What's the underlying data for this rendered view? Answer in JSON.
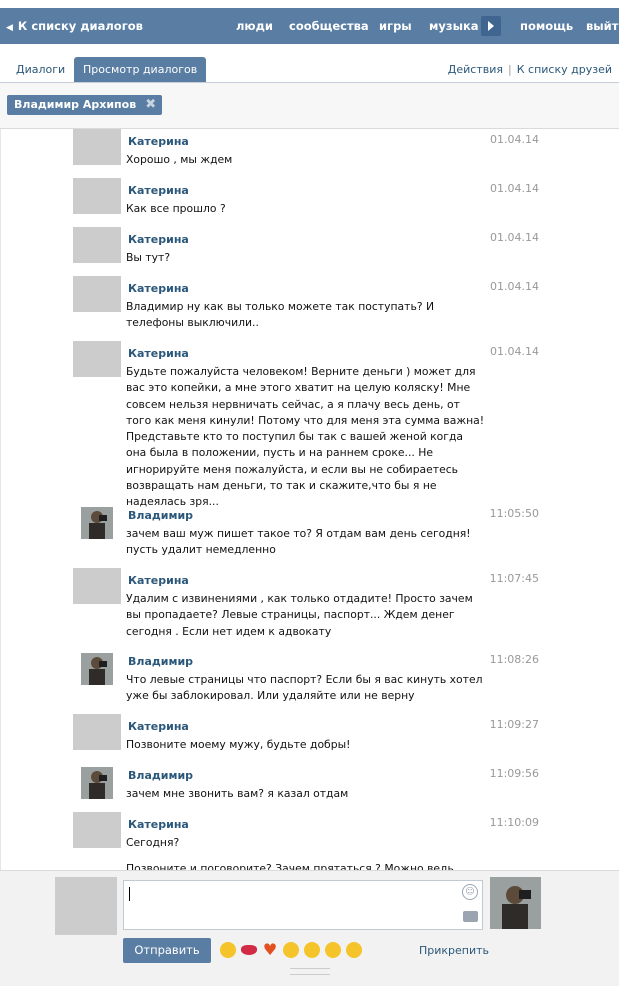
{
  "topbar": {
    "back_label": "К списку диалогов",
    "nav": [
      "люди",
      "сообщества",
      "игры",
      "музыка",
      "помощь",
      "выйти"
    ]
  },
  "tabs": [
    "Диалоги",
    "Просмотр диалогов"
  ],
  "actions": {
    "actions_label": "Действия",
    "friends_label": "К списку друзей"
  },
  "filter": {
    "chip_label": "Владимир Архипов"
  },
  "messages": [
    {
      "author": "Катерина",
      "time": "01.04.14",
      "text": "Хорошо , мы ждем"
    },
    {
      "author": "Катерина",
      "time": "01.04.14",
      "text": "Как все прошло ?"
    },
    {
      "author": "Катерина",
      "time": "01.04.14",
      "text": "Вы тут?"
    },
    {
      "author": "Катерина",
      "time": "01.04.14",
      "text": "Владимир ну как вы только можете так поступать? И телефоны выключили.."
    },
    {
      "author": "Катерина",
      "time": "01.04.14",
      "text": "Будьте пожалуйста человеком! Верните деньги ) может для вас это копейки, а мне этого хватит на целую коляску! Мне совсем нельзя нервничать сейчас, а я плачу весь день, от того как меня кинули! Потому что для меня эта сумма важна! Представьте кто то поступил бы так с вашей женой когда она была в положении, пусть и на раннем сроке... Не игнорируйте меня пожалуйста, и если вы не собираетесь возвращать нам деньги, то так и скажите,что бы я не надеялась зря..."
    },
    {
      "author": "Владимир",
      "time": "11:05:50",
      "text": "зачем ваш муж пишет такое то? Я отдам вам день сегодня! пусть удалит немедленно"
    },
    {
      "author": "Катерина",
      "time": "11:07:45",
      "text": "Удалим с извинениями , как только отдадите! Просто зачем вы пропадаете? Левые страницы, паспорт... Ждем денег сегодня . Если нет идем к адвокату"
    },
    {
      "author": "Владимир",
      "time": "11:08:26",
      "text": "Что левые страницы что паспорт? Если бы я вас кинуть хотел уже бы заблокировал. Или удаляйте или не верну"
    },
    {
      "author": "Катерина",
      "time": "11:09:27",
      "text": "Позвоните моему мужу, будьте добры!"
    },
    {
      "author": "Владимир",
      "time": "11:09:56",
      "text": "зачем мне звонить вам? я казал отдам"
    },
    {
      "author": "Катерина",
      "time": "11:10:09",
      "text": "Сегодня?"
    },
    {
      "author": "Катерина",
      "time": "",
      "text": "Позвоните и поговорите? Зачем прятаться ? Можно ведь обсудить"
    }
  ],
  "compose": {
    "send_label": "Отправить",
    "attach_label": "Прикрепить",
    "emojis": [
      "grinning-face",
      "kiss-lips",
      "orange-heart",
      "tears-of-joy",
      "crying-face",
      "relieved-face",
      "grinning-face-2"
    ]
  }
}
